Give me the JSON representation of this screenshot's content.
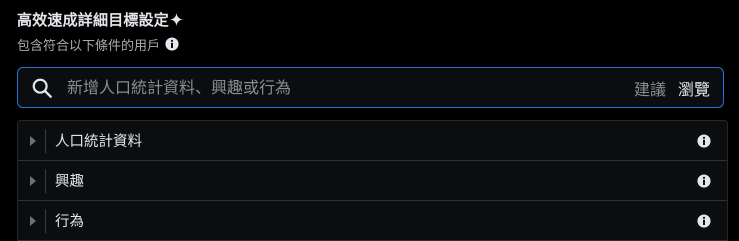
{
  "header": {
    "title": "高效速成詳細目標設定",
    "subtitle": "包含符合以下條件的用戶"
  },
  "search": {
    "placeholder": "新增人口統計資料、興趣或行為",
    "value": "",
    "suggest_label": "建議",
    "browse_label": "瀏覽"
  },
  "categories": [
    {
      "label": "人口統計資料",
      "expanded": false
    },
    {
      "label": "興趣",
      "expanded": false
    },
    {
      "label": "行為",
      "expanded": false
    }
  ],
  "icons": {
    "sparkle": "sparkle-icon",
    "info": "info-icon",
    "search": "search-icon",
    "caret": "caret-right-icon"
  },
  "colors": {
    "background": "#000000",
    "text_primary": "#e4e6eb",
    "text_secondary": "#a8abaf",
    "accent_border": "#2d6fd6"
  }
}
